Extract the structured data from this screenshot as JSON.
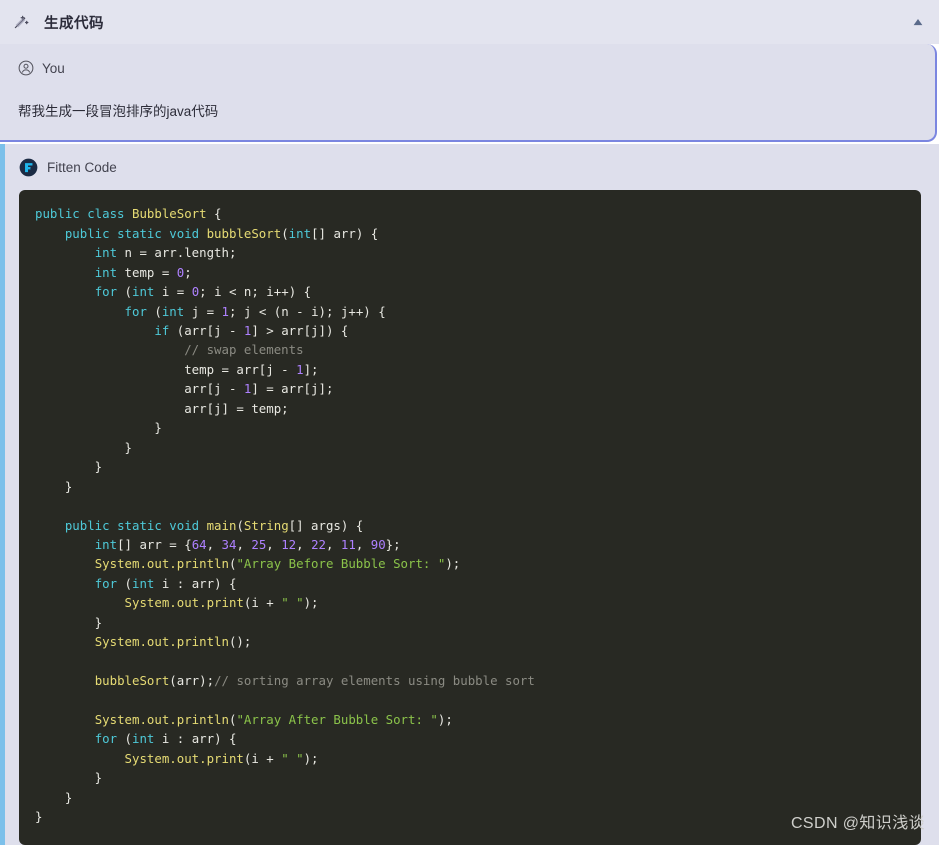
{
  "header": {
    "title": "生成代码",
    "wand_icon": "magic-wand-icon",
    "collapse_icon": "chevron-up-icon"
  },
  "conversation": {
    "user": {
      "avatar_icon": "user-circle-icon",
      "name": "You",
      "message": "帮我生成一段冒泡排序的java代码"
    },
    "assistant": {
      "logo_icon": "fitten-code-logo-icon",
      "name": "Fitten Code",
      "code_language": "java",
      "code_lines": [
        [
          {
            "t": "public ",
            "c": "tk-kw"
          },
          {
            "t": "class ",
            "c": "tk-kw"
          },
          {
            "t": "BubbleSort",
            "c": "tk-type"
          },
          {
            "t": " {",
            "c": "tk-pl"
          }
        ],
        [
          {
            "t": "    ",
            "c": "tk-pl"
          },
          {
            "t": "public ",
            "c": "tk-kw"
          },
          {
            "t": "static ",
            "c": "tk-kw"
          },
          {
            "t": "void ",
            "c": "tk-kw"
          },
          {
            "t": "bubbleSort",
            "c": "tk-fn"
          },
          {
            "t": "(",
            "c": "tk-pl"
          },
          {
            "t": "int",
            "c": "tk-kw"
          },
          {
            "t": "[] arr) {",
            "c": "tk-pl"
          }
        ],
        [
          {
            "t": "        ",
            "c": "tk-pl"
          },
          {
            "t": "int",
            "c": "tk-kw"
          },
          {
            "t": " n = arr.length;",
            "c": "tk-pl"
          }
        ],
        [
          {
            "t": "        ",
            "c": "tk-pl"
          },
          {
            "t": "int",
            "c": "tk-kw"
          },
          {
            "t": " temp = ",
            "c": "tk-pl"
          },
          {
            "t": "0",
            "c": "tk-num"
          },
          {
            "t": ";",
            "c": "tk-pl"
          }
        ],
        [
          {
            "t": "        ",
            "c": "tk-pl"
          },
          {
            "t": "for",
            "c": "tk-kw"
          },
          {
            "t": " (",
            "c": "tk-pl"
          },
          {
            "t": "int",
            "c": "tk-kw"
          },
          {
            "t": " i = ",
            "c": "tk-pl"
          },
          {
            "t": "0",
            "c": "tk-num"
          },
          {
            "t": "; i < n; i++) {",
            "c": "tk-pl"
          }
        ],
        [
          {
            "t": "            ",
            "c": "tk-pl"
          },
          {
            "t": "for",
            "c": "tk-kw"
          },
          {
            "t": " (",
            "c": "tk-pl"
          },
          {
            "t": "int",
            "c": "tk-kw"
          },
          {
            "t": " j = ",
            "c": "tk-pl"
          },
          {
            "t": "1",
            "c": "tk-num"
          },
          {
            "t": "; j < (n - i); j++) {",
            "c": "tk-pl"
          }
        ],
        [
          {
            "t": "                ",
            "c": "tk-pl"
          },
          {
            "t": "if",
            "c": "tk-kw"
          },
          {
            "t": " (arr[j - ",
            "c": "tk-pl"
          },
          {
            "t": "1",
            "c": "tk-num"
          },
          {
            "t": "] > arr[j]) {",
            "c": "tk-pl"
          }
        ],
        [
          {
            "t": "                    ",
            "c": "tk-pl"
          },
          {
            "t": "// swap elements",
            "c": "tk-cmt"
          }
        ],
        [
          {
            "t": "                    temp = arr[j - ",
            "c": "tk-pl"
          },
          {
            "t": "1",
            "c": "tk-num"
          },
          {
            "t": "];",
            "c": "tk-pl"
          }
        ],
        [
          {
            "t": "                    arr[j - ",
            "c": "tk-pl"
          },
          {
            "t": "1",
            "c": "tk-num"
          },
          {
            "t": "] = arr[j];",
            "c": "tk-pl"
          }
        ],
        [
          {
            "t": "                    arr[j] = temp;",
            "c": "tk-pl"
          }
        ],
        [
          {
            "t": "                }",
            "c": "tk-pl"
          }
        ],
        [
          {
            "t": "            }",
            "c": "tk-pl"
          }
        ],
        [
          {
            "t": "        }",
            "c": "tk-pl"
          }
        ],
        [
          {
            "t": "    }",
            "c": "tk-pl"
          }
        ],
        [
          {
            "t": "",
            "c": "tk-pl"
          }
        ],
        [
          {
            "t": "    ",
            "c": "tk-pl"
          },
          {
            "t": "public ",
            "c": "tk-kw"
          },
          {
            "t": "static ",
            "c": "tk-kw"
          },
          {
            "t": "void ",
            "c": "tk-kw"
          },
          {
            "t": "main",
            "c": "tk-fn"
          },
          {
            "t": "(",
            "c": "tk-pl"
          },
          {
            "t": "String",
            "c": "tk-type"
          },
          {
            "t": "[] args) {",
            "c": "tk-pl"
          }
        ],
        [
          {
            "t": "        ",
            "c": "tk-pl"
          },
          {
            "t": "int",
            "c": "tk-kw"
          },
          {
            "t": "[] arr = {",
            "c": "tk-pl"
          },
          {
            "t": "64",
            "c": "tk-num"
          },
          {
            "t": ", ",
            "c": "tk-pl"
          },
          {
            "t": "34",
            "c": "tk-num"
          },
          {
            "t": ", ",
            "c": "tk-pl"
          },
          {
            "t": "25",
            "c": "tk-num"
          },
          {
            "t": ", ",
            "c": "tk-pl"
          },
          {
            "t": "12",
            "c": "tk-num"
          },
          {
            "t": ", ",
            "c": "tk-pl"
          },
          {
            "t": "22",
            "c": "tk-num"
          },
          {
            "t": ", ",
            "c": "tk-pl"
          },
          {
            "t": "11",
            "c": "tk-num"
          },
          {
            "t": ", ",
            "c": "tk-pl"
          },
          {
            "t": "90",
            "c": "tk-num"
          },
          {
            "t": "};",
            "c": "tk-pl"
          }
        ],
        [
          {
            "t": "        ",
            "c": "tk-pl"
          },
          {
            "t": "System.out.println",
            "c": "tk-fn"
          },
          {
            "t": "(",
            "c": "tk-pl"
          },
          {
            "t": "\"Array Before Bubble Sort: \"",
            "c": "tk-str"
          },
          {
            "t": ");",
            "c": "tk-pl"
          }
        ],
        [
          {
            "t": "        ",
            "c": "tk-pl"
          },
          {
            "t": "for",
            "c": "tk-kw"
          },
          {
            "t": " (",
            "c": "tk-pl"
          },
          {
            "t": "int",
            "c": "tk-kw"
          },
          {
            "t": " i : arr) {",
            "c": "tk-pl"
          }
        ],
        [
          {
            "t": "            ",
            "c": "tk-pl"
          },
          {
            "t": "System.out.print",
            "c": "tk-fn"
          },
          {
            "t": "(i + ",
            "c": "tk-pl"
          },
          {
            "t": "\" \"",
            "c": "tk-str"
          },
          {
            "t": ");",
            "c": "tk-pl"
          }
        ],
        [
          {
            "t": "        }",
            "c": "tk-pl"
          }
        ],
        [
          {
            "t": "        ",
            "c": "tk-pl"
          },
          {
            "t": "System.out.println",
            "c": "tk-fn"
          },
          {
            "t": "();",
            "c": "tk-pl"
          }
        ],
        [
          {
            "t": "",
            "c": "tk-pl"
          }
        ],
        [
          {
            "t": "        ",
            "c": "tk-pl"
          },
          {
            "t": "bubbleSort",
            "c": "tk-fn"
          },
          {
            "t": "(arr);",
            "c": "tk-pl"
          },
          {
            "t": "// sorting array elements using bubble sort",
            "c": "tk-cmt"
          }
        ],
        [
          {
            "t": "",
            "c": "tk-pl"
          }
        ],
        [
          {
            "t": "        ",
            "c": "tk-pl"
          },
          {
            "t": "System.out.println",
            "c": "tk-fn"
          },
          {
            "t": "(",
            "c": "tk-pl"
          },
          {
            "t": "\"Array After Bubble Sort: \"",
            "c": "tk-str"
          },
          {
            "t": ");",
            "c": "tk-pl"
          }
        ],
        [
          {
            "t": "        ",
            "c": "tk-pl"
          },
          {
            "t": "for",
            "c": "tk-kw"
          },
          {
            "t": " (",
            "c": "tk-pl"
          },
          {
            "t": "int",
            "c": "tk-kw"
          },
          {
            "t": " i : arr) {",
            "c": "tk-pl"
          }
        ],
        [
          {
            "t": "            ",
            "c": "tk-pl"
          },
          {
            "t": "System.out.print",
            "c": "tk-fn"
          },
          {
            "t": "(i + ",
            "c": "tk-pl"
          },
          {
            "t": "\" \"",
            "c": "tk-str"
          },
          {
            "t": ");",
            "c": "tk-pl"
          }
        ],
        [
          {
            "t": "        }",
            "c": "tk-pl"
          }
        ],
        [
          {
            "t": "    }",
            "c": "tk-pl"
          }
        ],
        [
          {
            "t": "}",
            "c": "tk-pl"
          }
        ]
      ]
    }
  },
  "watermark": "CSDN @知识浅谈",
  "colors": {
    "header_bg": "#e3e4ef",
    "message_bg": "#dedfec",
    "user_outline": "#7b86e0",
    "assistant_accent": "#7cc0ea",
    "code_bg": "#282923",
    "keyword": "#4ec9d8",
    "type": "#e6db74",
    "number": "#ae81ff",
    "string": "#8bc34a",
    "comment": "#8b8b83",
    "plain": "#e8e8e2"
  }
}
